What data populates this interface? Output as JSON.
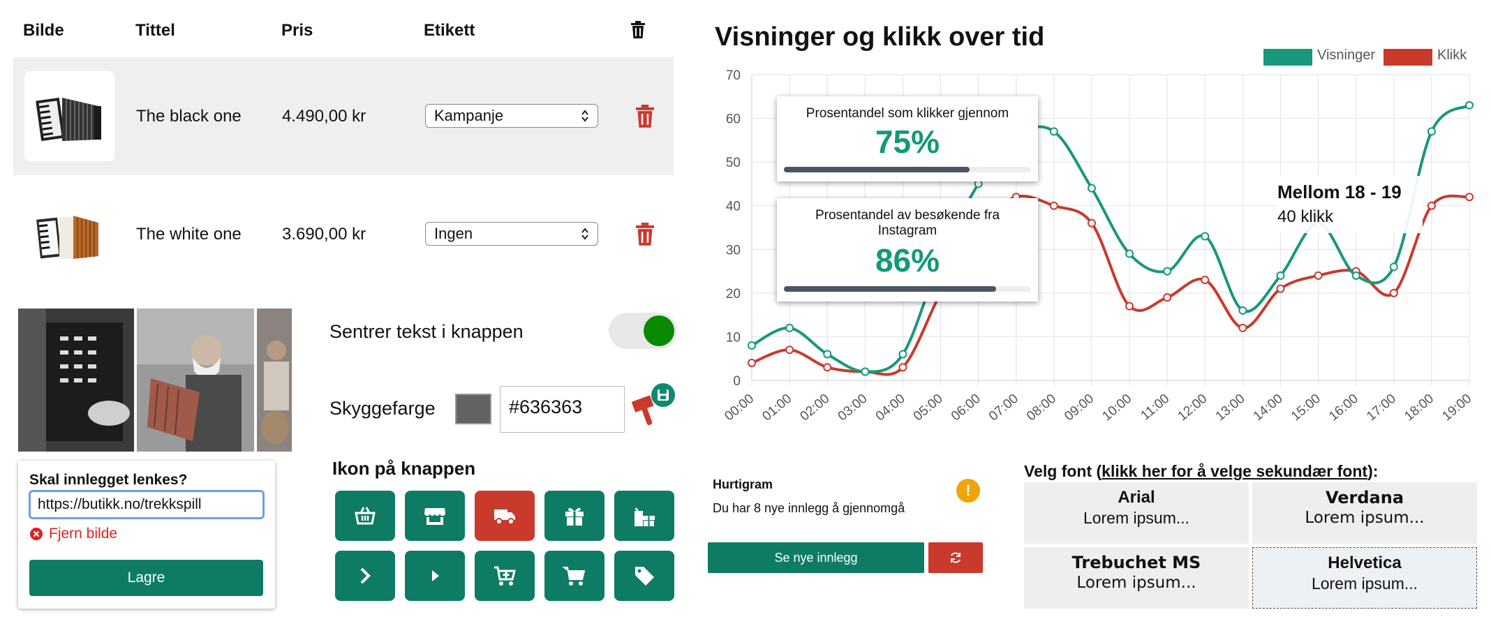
{
  "table": {
    "headers": {
      "image": "Bilde",
      "title": "Tittel",
      "price": "Pris",
      "label": "Etikett"
    },
    "rows": [
      {
        "title": "The black one",
        "price": "4.490,00 kr",
        "label": "Kampanje"
      },
      {
        "title": "The white one",
        "price": "3.690,00 kr",
        "label": "Ingen"
      }
    ]
  },
  "link_popup": {
    "question": "Skal innlegget lenkes?",
    "url_value": "https://butikk.no/trekkspill",
    "remove_label": "Fjern bilde",
    "save_label": "Lagre"
  },
  "settings": {
    "center_text_label": "Sentrer tekst i knappen",
    "center_text_on": true,
    "shadow_label": "Skyggefarge",
    "shadow_color": "#636363",
    "icon_label": "Ikon på knappen",
    "icons": [
      "basket-icon",
      "store-icon",
      "truck-icon",
      "gift-icon",
      "gifts-icon",
      "chevron-right-icon",
      "play-icon",
      "cart-plus-icon",
      "cart-icon",
      "tag-icon"
    ],
    "selected_icon": "truck-icon"
  },
  "chart_data": {
    "type": "line",
    "title": "Visninger og klikk over tid",
    "x": [
      "00:00",
      "01:00",
      "02:00",
      "03:00",
      "04:00",
      "05:00",
      "06:00",
      "07:00",
      "08:00",
      "09:00",
      "10:00",
      "11:00",
      "12:00",
      "13:00",
      "14:00",
      "15:00",
      "16:00",
      "17:00",
      "18:00",
      "19:00"
    ],
    "series": [
      {
        "name": "Visninger",
        "color": "#17987a",
        "values": [
          8,
          12,
          6,
          2,
          6,
          28,
          45,
          56,
          57,
          44,
          29,
          25,
          33,
          16,
          24,
          36,
          24,
          26,
          57,
          63
        ]
      },
      {
        "name": "Klikk",
        "color": "#c93a2d",
        "values": [
          4,
          7,
          3,
          2,
          3,
          20,
          35,
          42,
          40,
          36,
          17,
          19,
          23,
          12,
          21,
          24,
          25,
          20,
          40,
          42
        ]
      }
    ],
    "ylim": [
      0,
      70
    ],
    "yticks": [
      0,
      10,
      20,
      30,
      40,
      50,
      60,
      70
    ],
    "grid": true,
    "legend": "top-right",
    "tooltip": {
      "title": "Mellom 18 - 19",
      "value": "40 klikk"
    },
    "stats": [
      {
        "label": "Prosentandel som klikker gjennom",
        "value": "75%",
        "fraction": 0.75
      },
      {
        "label": "Prosentandel av besøkende fra Instagram",
        "value": "86%",
        "fraction": 0.86
      }
    ]
  },
  "hurtigram": {
    "title": "Hurtigram",
    "text": "Du har 8 nye innlegg å gjennomgå",
    "button": "Se nye innlegg",
    "warn_glyph": "!"
  },
  "fonts": {
    "heading_prefix": "Velg font (",
    "heading_link": "klikk her for å velge sekundær font",
    "heading_suffix": "):",
    "options": [
      {
        "name": "Arial",
        "sample": "Lorem ipsum..."
      },
      {
        "name": "Verdana",
        "sample": "Lorem ipsum..."
      },
      {
        "name": "Trebuchet MS",
        "sample": "Lorem ipsum..."
      },
      {
        "name": "Helvetica",
        "sample": "Lorem ipsum..."
      }
    ]
  }
}
